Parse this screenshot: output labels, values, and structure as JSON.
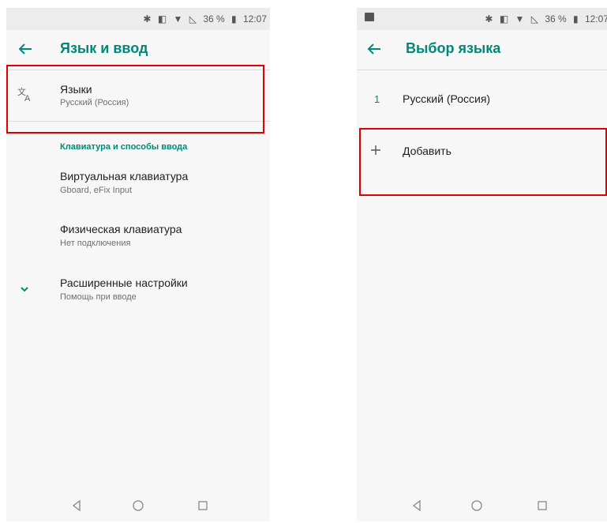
{
  "colors": {
    "accent": "#00897b",
    "highlight": "#e00000",
    "background": "#f7f7f7",
    "statusbar": "#ececec"
  },
  "left": {
    "status": {
      "battery": "36 %",
      "time": "12:07",
      "icons": [
        "bluetooth-icon",
        "vibrate-icon",
        "wifi-icon",
        "no-signal-icon",
        "battery-icon"
      ]
    },
    "appbar": {
      "title": "Язык и ввод",
      "back_icon": "arrow-left-icon"
    },
    "languages": {
      "title": "Языки",
      "subtitle": "Русский (Россия)",
      "icon": "translate-icon"
    },
    "section_header": "Клавиатура и способы ввода",
    "virtual_keyboard": {
      "title": "Виртуальная клавиатура",
      "subtitle": "Gboard, eFix Input"
    },
    "physical_keyboard": {
      "title": "Физическая клавиатура",
      "subtitle": "Нет подключения"
    },
    "advanced": {
      "title": "Расширенные настройки",
      "subtitle": "Помощь при вводе",
      "icon": "chevron-down-icon"
    },
    "navbar": [
      "back-nav-icon",
      "home-nav-icon",
      "recents-nav-icon"
    ]
  },
  "right": {
    "status": {
      "battery": "36 %",
      "time": "12:07",
      "icons": [
        "image-notification-icon",
        "bluetooth-icon",
        "vibrate-icon",
        "wifi-icon",
        "no-signal-icon",
        "battery-icon"
      ]
    },
    "appbar": {
      "title": "Выбор языка",
      "back_icon": "arrow-left-icon"
    },
    "language_item": {
      "index": "1",
      "name": "Русский (Россия)"
    },
    "add_item": {
      "label": "Добавить",
      "icon": "plus-icon"
    },
    "navbar": [
      "back-nav-icon",
      "home-nav-icon",
      "recents-nav-icon"
    ]
  }
}
